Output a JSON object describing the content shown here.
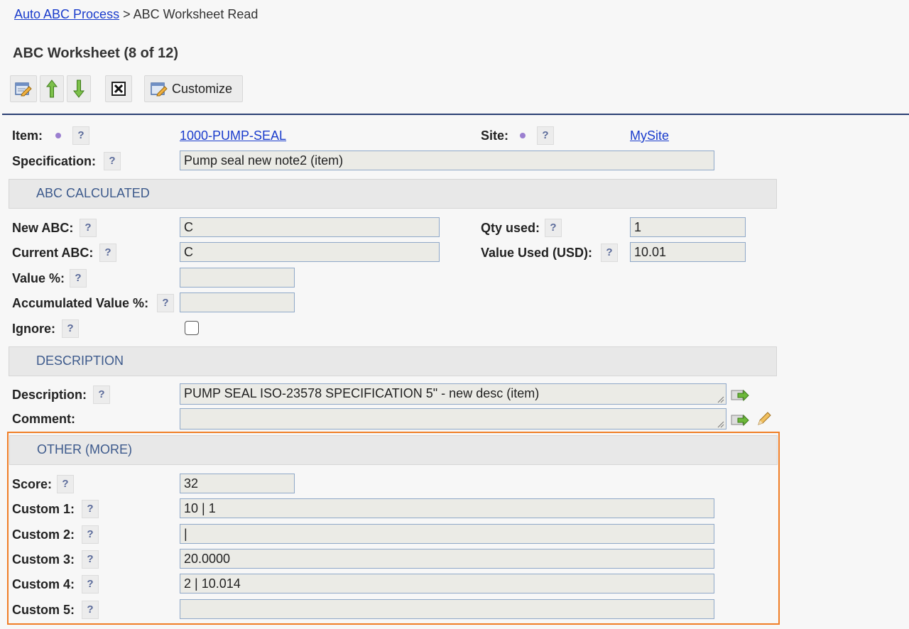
{
  "breadcrumb": {
    "parent": "Auto ABC Process",
    "separator": " > ",
    "current": "ABC Worksheet Read"
  },
  "page_title": "ABC Worksheet (8 of 12)",
  "toolbar": {
    "customize_label": "Customize"
  },
  "help_glyph": "?",
  "header_fields": {
    "item_label": "Item:",
    "item_value": "1000-PUMP-SEAL",
    "site_label": "Site:",
    "site_value": "MySite",
    "spec_label": "Specification:",
    "spec_value": "Pump seal new note2 (item)"
  },
  "sections": {
    "abc_calculated": "ABC CALCULATED",
    "description": "DESCRIPTION",
    "other": "OTHER (MORE)"
  },
  "abc": {
    "new_abc_label": "New ABC:",
    "new_abc_value": "C",
    "current_abc_label": "Current ABC:",
    "current_abc_value": "C",
    "value_pct_label": "Value %:",
    "value_pct_value": "",
    "acc_value_pct_label": "Accumulated Value %:",
    "acc_value_pct_value": "",
    "ignore_label": "Ignore:",
    "qty_used_label": "Qty used:",
    "qty_used_value": "1",
    "value_used_label": "Value Used (USD):",
    "value_used_value": "10.01"
  },
  "description": {
    "description_label": "Description:",
    "description_value": "PUMP SEAL ISO-23578 SPECIFICATION 5\" - new desc (item)",
    "comment_label": "Comment:",
    "comment_value": ""
  },
  "other": {
    "score_label": "Score:",
    "score_value": "32",
    "custom1_label": "Custom 1:",
    "custom1_value": "10 | 1",
    "custom2_label": "Custom 2:",
    "custom2_value": "|",
    "custom3_label": "Custom 3:",
    "custom3_value": "20.0000",
    "custom4_label": "Custom 4:",
    "custom4_value": "2 | 10.014",
    "custom5_label": "Custom 5:",
    "custom5_value": ""
  },
  "colors": {
    "accent_line": "#2b3f73",
    "highlight": "#f07e26",
    "section_text": "#3d5a8c",
    "link": "#1a3ccc"
  }
}
